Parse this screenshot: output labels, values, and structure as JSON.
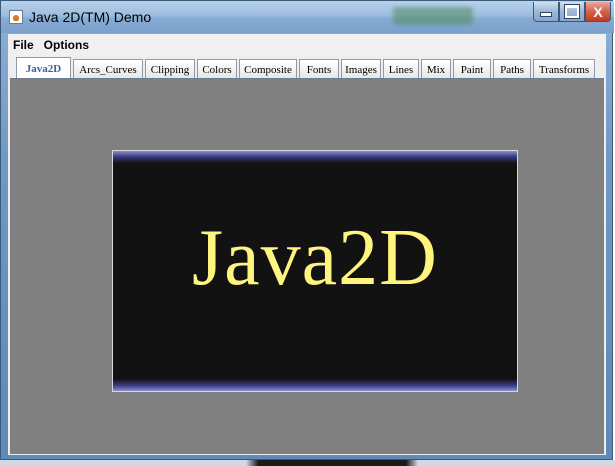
{
  "window": {
    "title": "Java 2D(TM) Demo",
    "title_icon": "java-cup-icon",
    "controls": {
      "minimize_icon": "minimize-icon",
      "maximize_icon": "maximize-icon",
      "close_icon": "close-icon",
      "close_glyph": "X"
    }
  },
  "menu": {
    "items": [
      {
        "label": "File"
      },
      {
        "label": "Options"
      }
    ]
  },
  "tabs": [
    {
      "label": "Java2D",
      "active": true
    },
    {
      "label": "Arcs_Curves",
      "active": false
    },
    {
      "label": "Clipping",
      "active": false
    },
    {
      "label": "Colors",
      "active": false
    },
    {
      "label": "Composite",
      "active": false
    },
    {
      "label": "Fonts",
      "active": false
    },
    {
      "label": "Images",
      "active": false
    },
    {
      "label": "Lines",
      "active": false
    },
    {
      "label": "Mix",
      "active": false
    },
    {
      "label": "Paint",
      "active": false
    },
    {
      "label": "Paths",
      "active": false
    },
    {
      "label": "Transforms",
      "active": false
    }
  ],
  "content": {
    "banner_text": "Java2D",
    "banner_text_color": "#fff47e",
    "banner_background": "#121212",
    "panel_background": "#808080",
    "band_color": "#8c8fd0"
  }
}
